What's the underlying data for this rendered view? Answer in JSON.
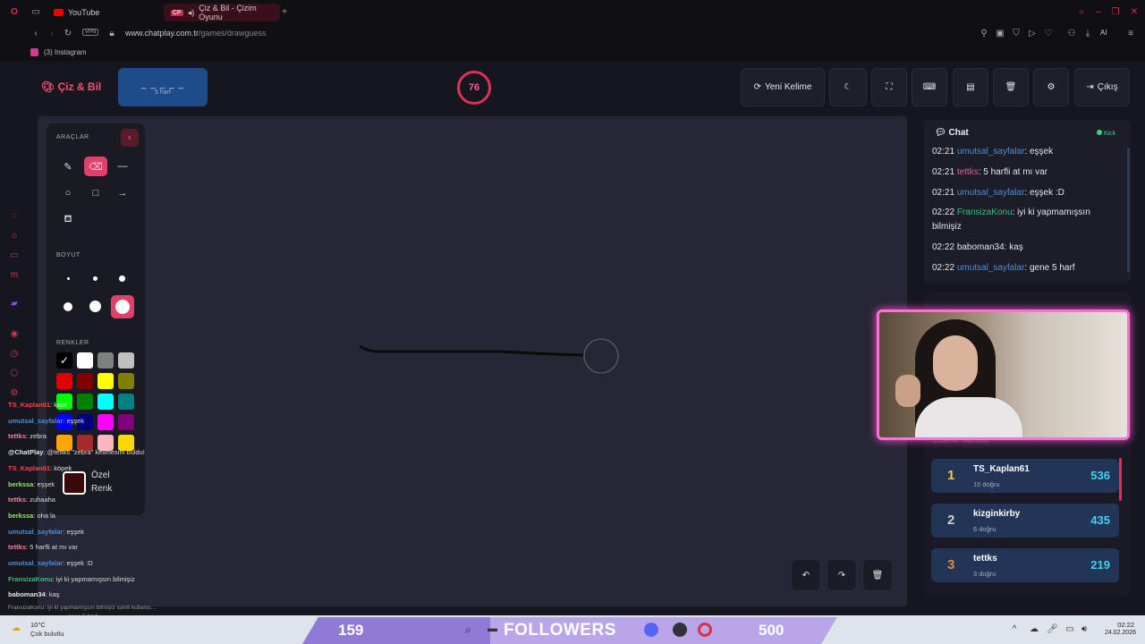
{
  "browser": {
    "tabs": [
      {
        "label": "YouTube"
      },
      {
        "label": "Çiz & Bil - Çizim Oyunu"
      }
    ],
    "url_prefix": "www.chatplay.com.tr",
    "url_path": "/games/drawguess",
    "vpn_label": "VPN",
    "ai_label": "AI",
    "bookmark": "(3) Instagram"
  },
  "header": {
    "logo": "Çiz & Bil",
    "word_mask": "_ _ _ _ _",
    "word_hint": "5 harf",
    "timer": "76",
    "new_word": "Yeni Kelime",
    "exit": "Çıkış"
  },
  "tools": {
    "title": "ARAÇLAR",
    "size_title": "BOYUT",
    "colors_title": "RENKLER",
    "custom_label_1": "Özel",
    "custom_label_2": "Renk",
    "colors": [
      "#000000",
      "#ffffff",
      "#808080",
      "#c0c0c0",
      "#e00000",
      "#800000",
      "#ffff00",
      "#808000",
      "#00ff00",
      "#008000",
      "#00ffff",
      "#008080",
      "#0000ff",
      "#000080",
      "#ff00ff",
      "#800080",
      "#ffa500",
      "#a52a2a",
      "#ffb6c1",
      "#ffd700"
    ]
  },
  "chat": {
    "title": "Chat",
    "kick": "Kick",
    "messages": [
      {
        "time": "02:21",
        "user": "umutsal_sayfalar",
        "text": "eşşek",
        "color": "#4b8fd6"
      },
      {
        "time": "02:21",
        "user": "tettks",
        "text": "5 harfli at mı var",
        "color": "#e0608a"
      },
      {
        "time": "02:21",
        "user": "umutsal_sayfalar",
        "text": "eşşek :D",
        "color": "#4b8fd6"
      },
      {
        "time": "02:22",
        "user": "FransizaKonu",
        "text": "iyi ki yapmamışsın bilmişiz",
        "color": "#33c27a"
      },
      {
        "time": "02:22",
        "user": "baboman34",
        "text": "kaş",
        "color": "#e6e6e6"
      },
      {
        "time": "02:22",
        "user": "umutsal_sayfalar",
        "text": "gene 5 harf",
        "color": "#4b8fd6"
      }
    ]
  },
  "leaderboard": {
    "title": "Liderlik Tablosu",
    "rows": [
      {
        "rank": "1",
        "name": "TS_Kaplan61",
        "sub": "10 doğru",
        "score": "536",
        "rank_color": "#f2c94c"
      },
      {
        "rank": "2",
        "name": "kizginkirby",
        "sub": "6 doğru",
        "score": "435",
        "rank_color": "#d0d0d0"
      },
      {
        "rank": "3",
        "name": "tettks",
        "sub": "3 doğru",
        "score": "219",
        "rank_color": "#e08a3c"
      }
    ]
  },
  "overlay_chat": [
    {
      "user": "TS_Kaplan61",
      "text": "katır",
      "color": "#ff4040"
    },
    {
      "user": "umutsal_sayfalar",
      "text": "eşşek",
      "color": "#4b8fd6"
    },
    {
      "user": "tettks",
      "text": "zebra",
      "color": "#ff7aa0"
    },
    {
      "user": "@ChatPlay",
      "text": "@tettks \"zebra\" kelimesini buldu!",
      "color": "#e6e6e6"
    },
    {
      "user": "TS_Kaplan61",
      "text": "köpek",
      "color": "#ff4040"
    },
    {
      "user": "berkssa",
      "text": "eşşek",
      "color": "#9be36a"
    },
    {
      "user": "tettks",
      "text": "zuhaaha",
      "color": "#ff7aa0"
    },
    {
      "user": "berkssa",
      "text": "oha la",
      "color": "#9be36a"
    },
    {
      "user": "umutsal_sayfalar",
      "text": "eşşek",
      "color": "#4b8fd6"
    },
    {
      "user": "tettks",
      "text": "5 harfli at mı var",
      "color": "#ff7aa0"
    },
    {
      "user": "umutsal_sayfalar",
      "text": "eşşek :D",
      "color": "#4b8fd6"
    },
    {
      "user": "FransizaKonu",
      "text": "iyi ki yapmamışsın bilmişiz",
      "color": "#33c27a"
    },
    {
      "user": "baboman34",
      "text": "kaş",
      "color": "#e6e6e6"
    }
  ],
  "overlay_tail": "FransizaKonu: iyi ki yapmamışsın bilmişiz isimli kullanıc...",
  "overlay_tail2": "gene 5 harf",
  "followers": {
    "current": "159",
    "label": "FOLLOWERS",
    "goal": "500"
  },
  "taskbar": {
    "temp": "10°C",
    "weather": "Çok bulutlu",
    "time": "02:22",
    "date": "24.02.2026"
  }
}
